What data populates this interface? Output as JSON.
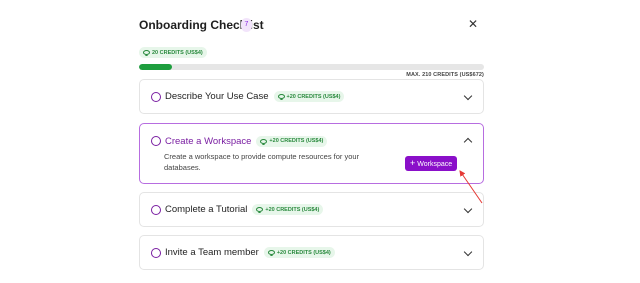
{
  "header": {
    "title": "Onboarding Checklist",
    "count": "7",
    "close_icon": "close-icon"
  },
  "credits": {
    "earned": "20 CREDITS (US$4)",
    "max": "MAX. 210 CREDITS (US$672)",
    "progress_fraction": 0.095
  },
  "items": [
    {
      "title": "Describe Your Use Case",
      "reward": "+20 CREDITS (US$4)",
      "expanded": false
    },
    {
      "title": "Create a Workspace",
      "reward": "+20 CREDITS (US$4)",
      "expanded": true,
      "description": "Create a workspace to provide compute resources for your databases.",
      "button_label": "Workspace",
      "button_icon": "+"
    },
    {
      "title": "Complete a Tutorial",
      "reward": "+20 CREDITS (US$4)",
      "expanded": false
    },
    {
      "title": "Invite a Team member",
      "reward": "+20 CREDITS (US$4)",
      "expanded": false
    }
  ],
  "colors": {
    "accent": "#8a0fc9",
    "progress": "#1e9e3e",
    "credit_bg": "#e7f6ea",
    "annotation_arrow": "#e53935"
  }
}
